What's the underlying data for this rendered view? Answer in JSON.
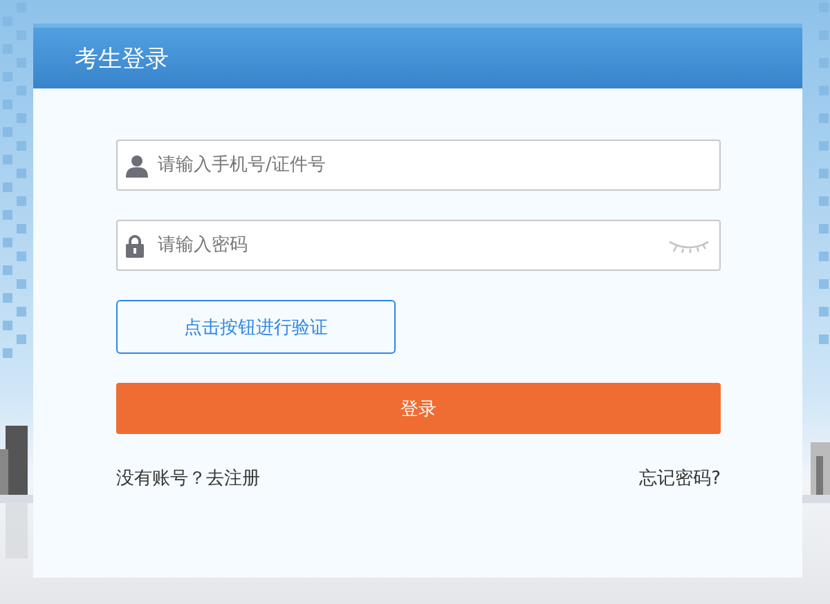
{
  "panel": {
    "title": "考生登录"
  },
  "account_field": {
    "placeholder": "请输入手机号/证件号"
  },
  "password_field": {
    "placeholder": "请输入密码"
  },
  "verify_button": {
    "label": "点击按钮进行验证"
  },
  "login_button": {
    "label": "登录"
  },
  "register_link": {
    "label": "没有账号？去注册"
  },
  "forgot_link": {
    "label": "忘记密码?"
  }
}
